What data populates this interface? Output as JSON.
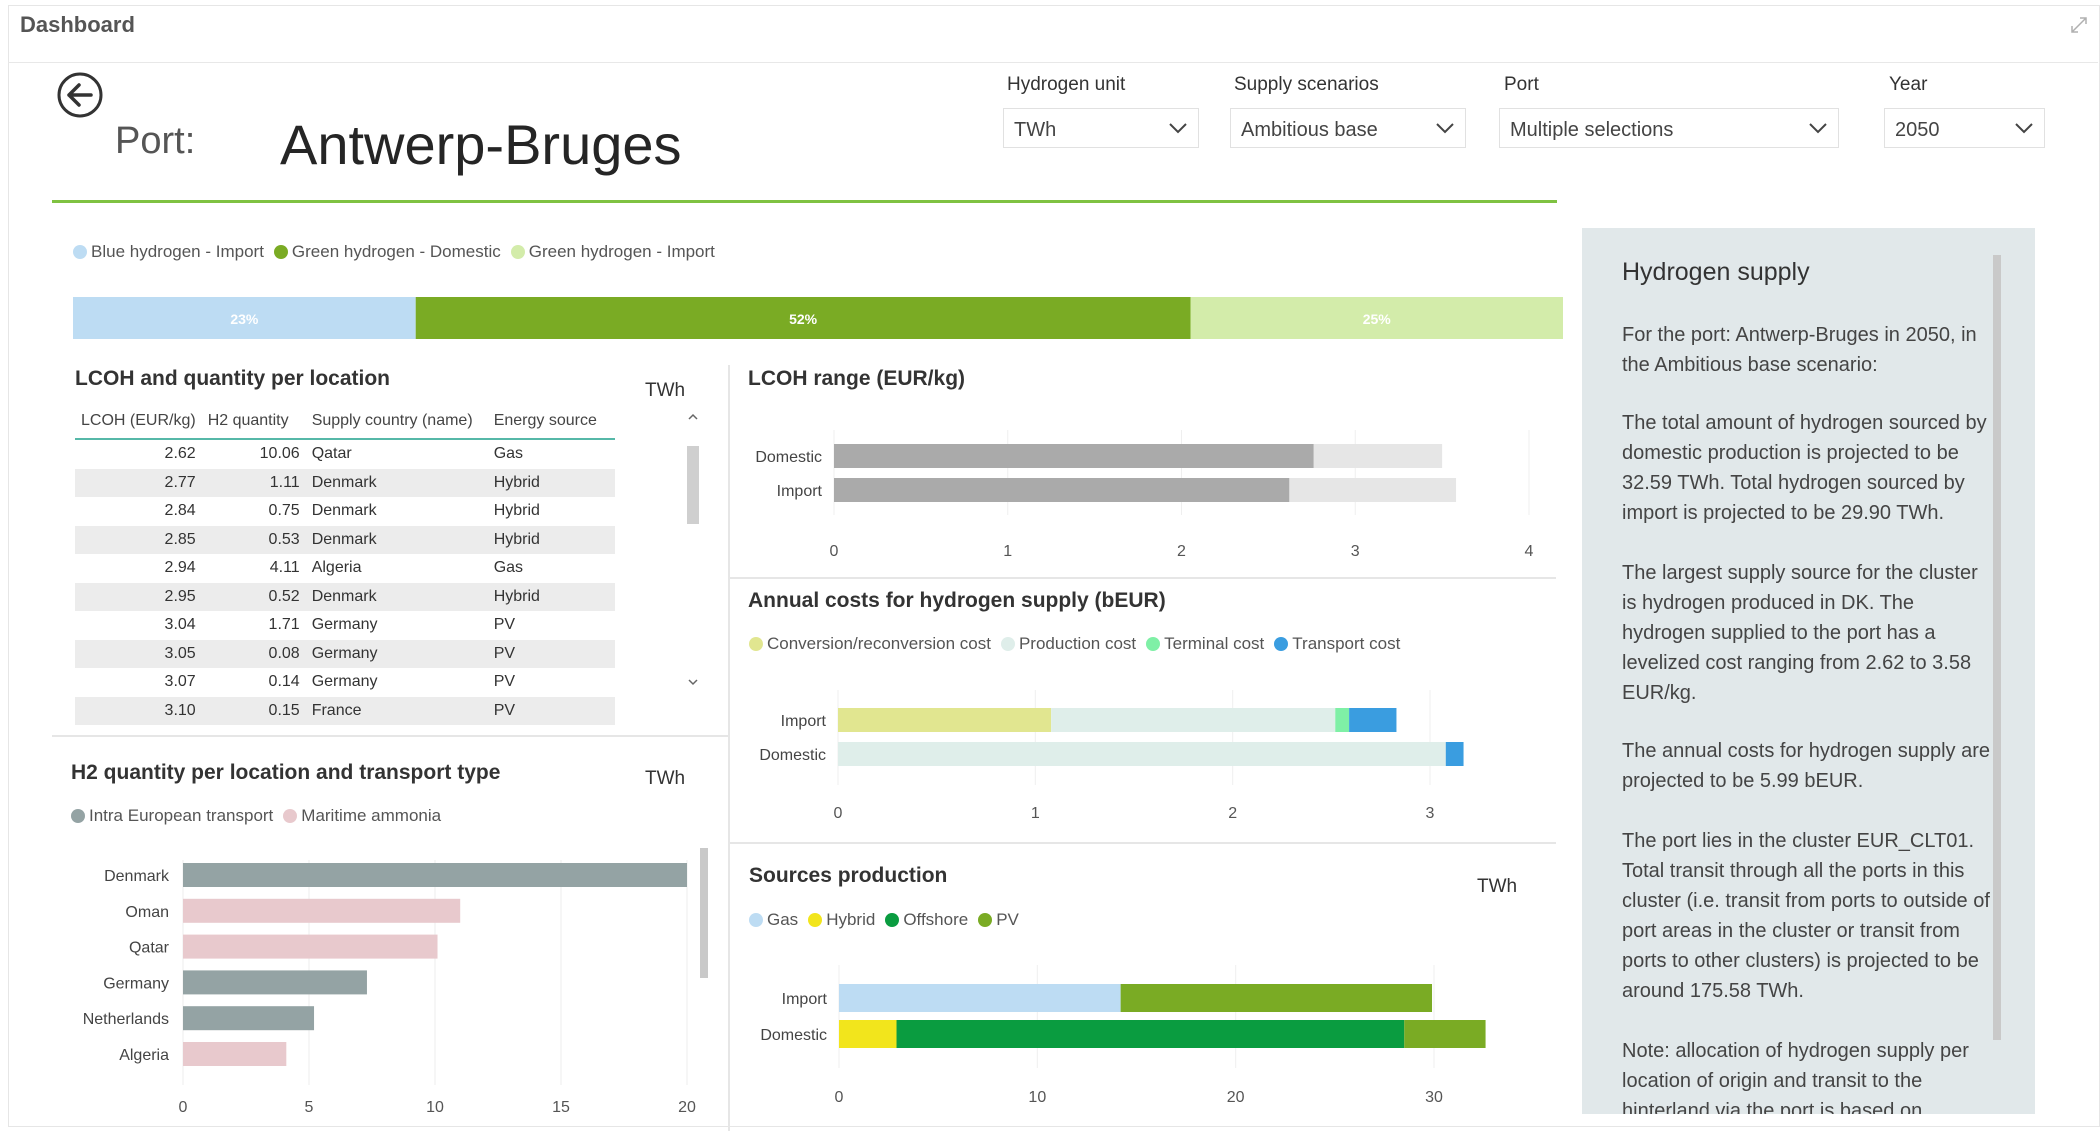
{
  "window": {
    "title": "Dashboard"
  },
  "header": {
    "port_label": "Port:",
    "port_name": "Antwerp-Bruges",
    "filters": [
      {
        "label": "Hydrogen unit",
        "value": "TWh"
      },
      {
        "label": "Supply scenarios",
        "value": "Ambitious base"
      },
      {
        "label": "Port",
        "value": "Multiple selections"
      },
      {
        "label": "Year",
        "value": "2050"
      }
    ]
  },
  "colors": {
    "blue_import": "#bddcf3",
    "green_domestic": "#7aab24",
    "green_import": "#d3ecaa",
    "accent_rule": "#7fc241",
    "panel_bg": "#e1e8ea"
  },
  "share_legend": {
    "items": [
      {
        "label": "Blue hydrogen - Import",
        "color": "#bddcf3"
      },
      {
        "label": "Green hydrogen - Domestic",
        "color": "#7aab24"
      },
      {
        "label": "Green hydrogen - Import",
        "color": "#d3ecaa"
      }
    ]
  },
  "share_bar": {
    "segments": [
      {
        "label": "23%",
        "value": 23,
        "color": "#bddcf3"
      },
      {
        "label": "52%",
        "value": 52,
        "color": "#7aab24"
      },
      {
        "label": "25%",
        "value": 25,
        "color": "#d3ecaa"
      }
    ]
  },
  "lcoh_table": {
    "title": "LCOH and quantity per location",
    "unit": "TWh",
    "columns": [
      "LCOH (EUR/kg)",
      "H2 quantity",
      "Supply country (name)",
      "Energy source"
    ],
    "rows": [
      [
        "2.62",
        "10.06",
        "Qatar",
        "Gas"
      ],
      [
        "2.77",
        "1.11",
        "Denmark",
        "Hybrid"
      ],
      [
        "2.84",
        "0.75",
        "Denmark",
        "Hybrid"
      ],
      [
        "2.85",
        "0.53",
        "Denmark",
        "Hybrid"
      ],
      [
        "2.94",
        "4.11",
        "Algeria",
        "Gas"
      ],
      [
        "2.95",
        "0.52",
        "Denmark",
        "Hybrid"
      ],
      [
        "3.04",
        "1.71",
        "Germany",
        "PV"
      ],
      [
        "3.05",
        "0.08",
        "Germany",
        "PV"
      ],
      [
        "3.07",
        "0.14",
        "Germany",
        "PV"
      ],
      [
        "3.10",
        "0.15",
        "France",
        "PV"
      ]
    ]
  },
  "transport_chart": {
    "title": "H2 quantity per location and transport type",
    "unit": "TWh",
    "legend": [
      {
        "label": "Intra European transport",
        "color": "#94a3a4"
      },
      {
        "label": "Maritime ammonia",
        "color": "#e8c9cd"
      }
    ]
  },
  "lcoh_range_chart": {
    "title": "LCOH range (EUR/kg)"
  },
  "annual_costs_chart": {
    "title": "Annual costs for hydrogen supply (bEUR)",
    "legend": [
      {
        "label": "Conversion/reconversion cost",
        "color": "#e1e690"
      },
      {
        "label": "Production cost",
        "color": "#dfeeea"
      },
      {
        "label": "Terminal cost",
        "color": "#7ff0a6"
      },
      {
        "label": "Transport cost",
        "color": "#3a9de0"
      }
    ]
  },
  "sources_chart": {
    "title": "Sources production",
    "unit": "TWh",
    "legend": [
      {
        "label": "Gas",
        "color": "#bddcf3"
      },
      {
        "label": "Hybrid",
        "color": "#f2e51c"
      },
      {
        "label": "Offshore",
        "color": "#0a9c40"
      },
      {
        "label": "PV",
        "color": "#7aab24"
      }
    ]
  },
  "chart_data": [
    {
      "type": "bar",
      "orientation": "horizontal",
      "stacked": true,
      "title": "",
      "categories": [
        "Hydrogen supply"
      ],
      "series": [
        {
          "name": "Blue hydrogen - Import",
          "values": [
            23
          ]
        },
        {
          "name": "Green hydrogen - Domestic",
          "values": [
            52
          ]
        },
        {
          "name": "Green hydrogen - Import",
          "values": [
            25
          ]
        }
      ],
      "xlim": [
        0,
        100
      ]
    },
    {
      "type": "bar",
      "orientation": "horizontal",
      "title": "H2 quantity per location and transport type",
      "xlabel": "",
      "ylabel": "",
      "unit": "TWh",
      "categories": [
        "Denmark",
        "Oman",
        "Qatar",
        "Germany",
        "Netherlands",
        "Algeria"
      ],
      "values": [
        20.0,
        11.0,
        10.1,
        7.3,
        5.2,
        4.1
      ],
      "transport": [
        "Intra European transport",
        "Maritime ammonia",
        "Maritime ammonia",
        "Intra European transport",
        "Intra European transport",
        "Maritime ammonia"
      ],
      "xlim": [
        0,
        20
      ],
      "xticks": [
        0,
        5,
        10,
        15,
        20
      ]
    },
    {
      "type": "bar",
      "orientation": "horizontal",
      "title": "LCOH range (EUR/kg)",
      "categories": [
        "Domestic",
        "Import"
      ],
      "range_min": [
        2.76,
        2.62
      ],
      "range_max": [
        3.5,
        3.58
      ],
      "xlim": [
        0,
        4
      ],
      "xticks": [
        0,
        1,
        2,
        3,
        4
      ]
    },
    {
      "type": "bar",
      "orientation": "horizontal",
      "stacked": true,
      "title": "Annual costs for hydrogen supply (bEUR)",
      "categories": [
        "Import",
        "Domestic"
      ],
      "series": [
        {
          "name": "Conversion/reconversion cost",
          "values": [
            1.08,
            0
          ]
        },
        {
          "name": "Production cost",
          "values": [
            1.44,
            3.08
          ]
        },
        {
          "name": "Terminal cost",
          "values": [
            0.07,
            0
          ]
        },
        {
          "name": "Transport cost",
          "values": [
            0.24,
            0.09
          ]
        }
      ],
      "xlim": [
        0,
        3.2
      ],
      "xticks": [
        0,
        1,
        2,
        3
      ]
    },
    {
      "type": "bar",
      "orientation": "horizontal",
      "stacked": true,
      "title": "Sources production",
      "unit": "TWh",
      "categories": [
        "Import",
        "Domestic"
      ],
      "series": [
        {
          "name": "Gas",
          "values": [
            14.2,
            0
          ]
        },
        {
          "name": "Hybrid",
          "values": [
            0,
            2.9
          ]
        },
        {
          "name": "Offshore",
          "values": [
            0,
            25.6
          ]
        },
        {
          "name": "PV",
          "values": [
            15.7,
            4.1
          ]
        }
      ],
      "xlim": [
        0,
        33
      ],
      "xticks": [
        0,
        10,
        20,
        30
      ]
    }
  ],
  "side_panel": {
    "title": "Hydrogen supply",
    "paragraphs": [
      "For the port: Antwerp-Bruges in 2050, in the Ambitious base scenario:",
      "The total amount of hydrogen sourced by domestic production is projected to be 32.59 TWh. Total hydrogen sourced by import is projected to be 29.90 TWh.",
      "The largest supply source for the cluster is hydrogen produced in DK. The hydrogen supplied to the port has a levelized cost ranging from 2.62 to 3.58 EUR/kg.",
      "The annual costs for hydrogen supply are projected to be 5.99 bEUR.",
      "The port lies in the cluster EUR_CLT01. Total transit through all the ports in this cluster (i.e. transit from ports to outside of port areas in the cluster or transit from ports to other clusters) is projected to be around 175.58 TWh.",
      "Note: allocation of hydrogen supply per location of origin and transit to the hinterland via the port is based on"
    ]
  }
}
